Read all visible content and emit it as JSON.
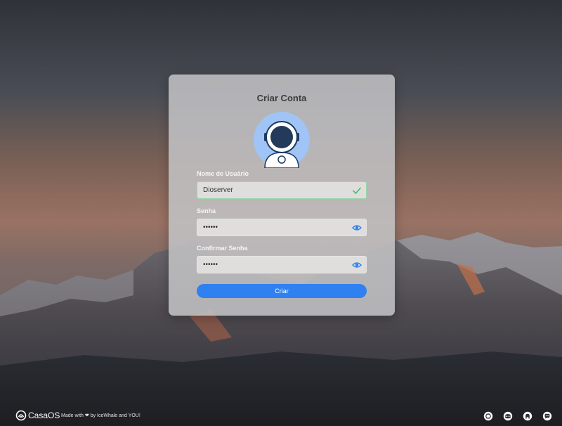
{
  "form": {
    "title": "Criar Conta",
    "username_label": "Nome de Usuário",
    "username_value": "Dioserver",
    "password_label": "Senha",
    "password_value": "123456",
    "confirm_label": "Confirmar Senha",
    "confirm_value": "123456",
    "submit_label": "Criar"
  },
  "footer": {
    "brand": "CasaOS",
    "made_prefix": "Made with",
    "heart": "❤",
    "made_suffix": "by IceWhale and YOU!"
  },
  "social_icons": [
    "fan-icon",
    "discord-icon",
    "github-icon",
    "chat-icon"
  ],
  "colors": {
    "accent": "#2f80f0",
    "valid": "#4cba6a",
    "avatar_bg": "#9fc4f5"
  }
}
